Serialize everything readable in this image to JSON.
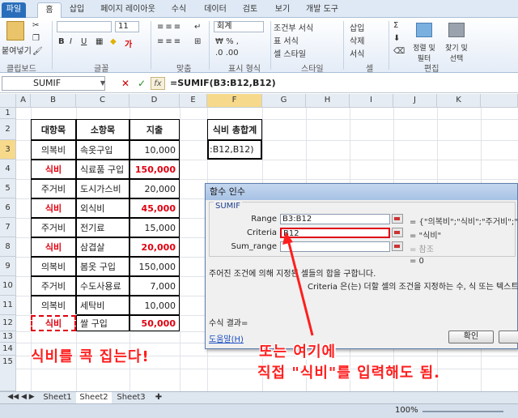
{
  "ribbon": {
    "tabs": [
      "파일",
      "홈",
      "삽입",
      "페이지 레이아웃",
      "수식",
      "데이터",
      "검토",
      "보기",
      "개발 도구"
    ],
    "groups": [
      "클립보드",
      "글꼴",
      "맞춤",
      "표시 형식",
      "스타일",
      "셀",
      "편집"
    ],
    "paste_label": "붙여넣기",
    "font_size": "11",
    "number_format": "회계",
    "style_items": [
      "조건부 서식",
      "표 서식",
      "셀 스타일"
    ],
    "cell_items": [
      "삽입",
      "삭제",
      "서식"
    ],
    "edit_items": [
      "정렬 및 필터",
      "찾기 및 선택"
    ]
  },
  "formula_bar": {
    "name_box": "SUMIF",
    "fx": "fx",
    "formula": "=SUMIF(B3:B12,B12)"
  },
  "columns": [
    "A",
    "B",
    "C",
    "D",
    "E",
    "F",
    "G",
    "H",
    "I",
    "J",
    "K"
  ],
  "rows": [
    "1",
    "2",
    "3",
    "4",
    "5",
    "6",
    "7",
    "8",
    "9",
    "10",
    "11",
    "12",
    "13",
    "14",
    "15"
  ],
  "table": {
    "headers": [
      "대항목",
      "소항목",
      "지출"
    ],
    "rows": [
      {
        "major": "의복비",
        "minor": "속옷구입",
        "amount": "10,000",
        "highlight": false
      },
      {
        "major": "식비",
        "minor": "식료품 구입",
        "amount": "150,000",
        "highlight": true
      },
      {
        "major": "주거비",
        "minor": "도시가스비",
        "amount": "20,000",
        "highlight": false
      },
      {
        "major": "식비",
        "minor": "외식비",
        "amount": "45,000",
        "highlight": true
      },
      {
        "major": "주거비",
        "minor": "전기료",
        "amount": "15,000",
        "highlight": false
      },
      {
        "major": "식비",
        "minor": "삼겹살",
        "amount": "20,000",
        "highlight": true
      },
      {
        "major": "의복비",
        "minor": "봄옷 구입",
        "amount": "150,000",
        "highlight": false
      },
      {
        "major": "주거비",
        "minor": "수도사용료",
        "amount": "7,000",
        "highlight": false
      },
      {
        "major": "의복비",
        "minor": "세탁비",
        "amount": "10,000",
        "highlight": false
      },
      {
        "major": "식비",
        "minor": "쌀 구입",
        "amount": "50,000",
        "highlight": true
      }
    ]
  },
  "summary": {
    "header": "식비 총합계",
    "value": ":B12,B12)"
  },
  "dialog": {
    "title": "함수 인수",
    "function": "SUMIF",
    "args": [
      {
        "label": "Range",
        "value": "B3:B12",
        "result": "= {\"의복비\";\"식비\";\"주거비\";\"식"
      },
      {
        "label": "Criteria",
        "value": "B12",
        "result": "= \"식비\""
      },
      {
        "label": "Sum_range",
        "value": "",
        "result": "= 참조"
      }
    ],
    "result_eq": "= 0",
    "description": "주어진 조건에 의해 지정된 셀들의 합을 구합니다.",
    "criteria_help": "Criteria  은(는) 더할 셀의 조건을 지정하는 수, 식 또는 텍스트",
    "formula_result": "수식 결과=",
    "help_link": "도움말(H)",
    "ok": "확인"
  },
  "sheets": [
    "Sheet1",
    "Sheet2",
    "Sheet3"
  ],
  "status_zoom": "100%",
  "annotations": {
    "left": "식비를 콕 집는다!",
    "right_line1": "또는 여기에",
    "right_line2": "직접 \"식비\"를 입력해도 됨."
  },
  "colors": {
    "red": "#e00010",
    "annotation": "#ff1e1e",
    "file_tab": "#2a6ebb"
  }
}
